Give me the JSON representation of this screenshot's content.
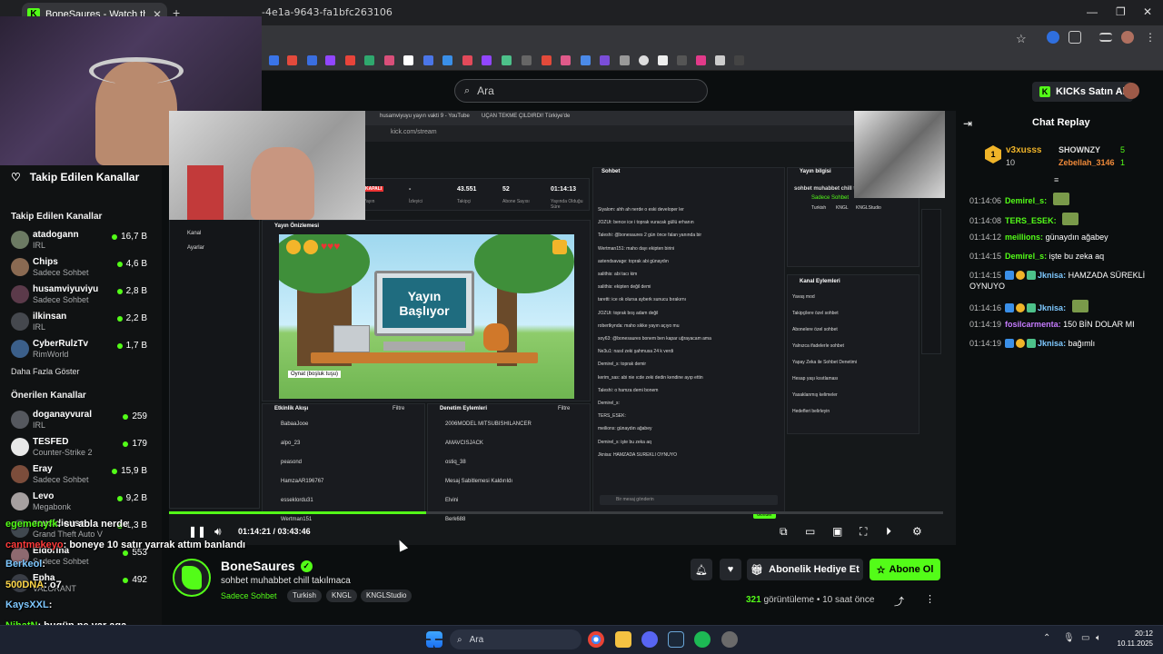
{
  "browser": {
    "tab_title": "BoneSaures - Watch the VO",
    "url_fragment": "-4e1a-9643-fa1bfc263106"
  },
  "header": {
    "search_placeholder": "Ara",
    "kicks_button": "KICKs Satın Al"
  },
  "sidebar": {
    "title": "Takip Edilen Kanallar",
    "followed_heading": "Takip Edilen Kanallar",
    "followed": [
      {
        "name": "atadogann",
        "category": "IRL",
        "viewers": "16,7 B",
        "color": "#6c7a63"
      },
      {
        "name": "Chips",
        "category": "Sadece Sohbet",
        "viewers": "4,6 B",
        "color": "#8a6a52"
      },
      {
        "name": "husamviyuviyu",
        "category": "Sadece Sohbet",
        "viewers": "2,8 B",
        "color": "#5b3a4a"
      },
      {
        "name": "ilkinsan",
        "category": "IRL",
        "viewers": "2,2 B",
        "color": "#45484e"
      },
      {
        "name": "CyberRulzTv",
        "category": "RimWorld",
        "viewers": "1,7 B",
        "color": "#3b5f8a"
      }
    ],
    "show_more": "Daha Fazla Göster",
    "recommended_heading": "Önerilen Kanallar",
    "recommended": [
      {
        "name": "doganayvural",
        "category": "IRL",
        "viewers": "259",
        "color": "#55585e"
      },
      {
        "name": "TESFED",
        "category": "Counter-Strike 2",
        "viewers": "179",
        "color": "#e8e8e8"
      },
      {
        "name": "Eray",
        "category": "Sadece Sohbet",
        "viewers": "15,9 B",
        "color": "#7c4d3b"
      },
      {
        "name": "Levo",
        "category": "Megabonk",
        "viewers": "9,2 B",
        "color": "#a6a0a0"
      },
      {
        "name": "zeusidiouss",
        "category": "Grand Theft Auto V",
        "viewers": "1,3 B",
        "color": "#40484f"
      },
      {
        "name": "Eldorina",
        "category": "Sadece Sohbet",
        "viewers": "553",
        "color": "#8e6a70"
      },
      {
        "name": "Epha",
        "category": "VALORANT",
        "viewers": "492",
        "color": "#3a3e46"
      }
    ]
  },
  "stream_overlay": {
    "dashboard_tabs": [
      "husamviyuyu yayın vakti 9 - YouTube",
      "UÇAN TEKME ÇILDIRDI! Türkiye'de"
    ],
    "dashboard_url": "kick.com/stream",
    "stats": [
      {
        "value": "KAPALI",
        "label": "Yayın"
      },
      {
        "value": "-",
        "label": "İzleyici"
      },
      {
        "value": "43.551",
        "label": "Takipçi"
      },
      {
        "value": "52",
        "label": "Abone Sayısı"
      },
      {
        "value": "01:14:13",
        "label": "Yayında Olduğu Süre"
      }
    ],
    "left_nav": [
      "Kanal",
      "Ayarlar"
    ],
    "preview_title": "Yayın Önizlemesi",
    "preview_text_1": "Yayın",
    "preview_text_2": "Başlıyor",
    "preview_tooltip": "Oynat (boşluk tuşu)",
    "activity_title": "Etkinlik Akışı",
    "activity_filter": "Filtre",
    "activity": [
      "BabaaJooe",
      "alpo_23",
      "peasond",
      "HamzaAR196767",
      "esseklordu31",
      "Wertman151"
    ],
    "mod_title": "Denetim Eylemleri",
    "mod": [
      "2006MODEL MITSUBISHILANCER",
      "AMAVCISJACK",
      "ostiq_38",
      "Mesaj Sabitlemesi Kaldırıldı",
      "Elvini",
      "Berk688"
    ],
    "inner_chat_title": "Sohbet",
    "inner_chat": [
      "Siyalom: ahh ah nerde o eski developer ler",
      "JOZUt: bence ice i toprak vuracak güllü erhanın",
      "Taleshi: @bonesaures 2 gün önce falan yanında bir",
      "Wertman151: maho dayı ekipten birini",
      "astendsavage: toprak abi günaydın",
      "salithis: abi tacı kim",
      "salithis: ekipten değil demi",
      "taretti: ice ok olursa ayberk sunucu bırakırnı",
      "JOZUt: toprak boş adam değil",
      "robertkynda: maho sikke yayın açıyo mu",
      "soy63: @bonesaures bonem ben kapar uğrayacam ama",
      "Ne3u1: nasıl zeki şahmusa 24 k verdi",
      "Demirel_s: toprak demir",
      "kerim_sas: abi nie ıcde zeki dedin kendine ayıp ettin",
      "Taleshi: o hamza demi bonem",
      "Demirel_s:",
      "TERS_ESEK:",
      "meilions: günaydın ağabey",
      "Demirel_s: işte bu zeka aq",
      "Jknisa: HAMZADA SÜREKLİ OYNUYO"
    ],
    "inner_chat_placeholder": "Bir mesaj gönderin",
    "inner_chat_send": "Gönder",
    "stream_info_title": "Yayın bilgisi",
    "stream_info_text": "sohbet muhabbet chill takılmaca",
    "stream_info_cat": "Sadece Sohbet",
    "stream_info_tags": [
      "Turkish",
      "KNGL",
      "KNGLStudio"
    ],
    "channel_actions_title": "Kanal Eylemleri",
    "channel_actions": [
      "Yavaş mod",
      "Takipçilere özel sohbet",
      "Abonelere özel sohbet",
      "Yalnızca ifadelerle sohbet",
      "Yapay Zeka ile Sohbet Denetimi",
      "Hesap yaşı kısıtlaması",
      "Yasaklanmış kelimeler",
      "Hedefleri belirleyin"
    ]
  },
  "player": {
    "time_current": "01:14:21",
    "time_total": "03:43:46",
    "progress": 0.332
  },
  "chat": {
    "title": "Chat Replay",
    "pinned": {
      "rank": "1",
      "user": "v3xusss",
      "count": "10",
      "user2": "SHOWNZY",
      "count2": "5",
      "user3": "Zebellah_3146",
      "count3": "1"
    },
    "messages": [
      {
        "time": "01:14:06",
        "user": "Demirel_s:",
        "color": "#53fc18",
        "text": ""
      },
      {
        "time": "01:14:08",
        "user": "TERS_ESEK:",
        "color": "#53fc18",
        "text": ""
      },
      {
        "time": "01:14:12",
        "user": "meillions:",
        "color": "#53fc18",
        "text": "günaydın ağabey"
      },
      {
        "time": "01:14:15",
        "user": "Demirel_s:",
        "color": "#53fc18",
        "text": "işte bu zeka aq"
      },
      {
        "time": "01:14:15",
        "user": "Jknisa:",
        "color": "#7ec8ff",
        "text": "HAMZADA SÜREKLİ OYNUYO"
      },
      {
        "time": "01:14:16",
        "user": "Jknisa:",
        "color": "#7ec8ff",
        "text": ""
      },
      {
        "time": "01:14:19",
        "user": "fosilcarmenta:",
        "color": "#c67bff",
        "text": "150 BİN DOLAR MI"
      },
      {
        "time": "01:14:19",
        "user": "Jknisa:",
        "color": "#7ec8ff",
        "text": "bağımlı"
      }
    ]
  },
  "overlay_chat": [
    {
      "user": "egemenyfk",
      "text": ": su abla nerde",
      "color": "#53fc18"
    },
    {
      "user": "cantmekeyo",
      "text": ": boneye 10 satır yarrak attım banlandı",
      "color": "#ff3b3b"
    },
    {
      "user": "Berkeol",
      "text": ":",
      "color": "#7ec8ff"
    },
    {
      "user": "500DNA",
      "text": ": o7",
      "color": "#ffd84a"
    },
    {
      "user": "KaysXXL",
      "text": ":",
      "color": "#7ec8ff"
    },
    {
      "user": "NihatN",
      "text": ": bugün ne var aga",
      "color": "#53fc18"
    },
    {
      "user": "musaalaa58Cavanii99",
      "text": ":",
      "color": "#ffffff"
    }
  ],
  "channel": {
    "name": "BoneSaures",
    "title": "sohbet muhabbet chill takılmaca",
    "category": "Sadece Sohbet",
    "tags": [
      "Turkish",
      "KNGL",
      "KNGLStudio"
    ],
    "gift_label": "Abonelik Hediye Et",
    "subscribe_label": "Abone Ol",
    "views_count": "321",
    "views_label": "görüntüleme",
    "time_ago": "10 saat önce"
  },
  "taskbar": {
    "search_placeholder": "Ara",
    "time": "20:12",
    "date": "10.11.2025"
  },
  "colors": {
    "accent": "#53fc18",
    "bg": "#0b0e0f"
  }
}
